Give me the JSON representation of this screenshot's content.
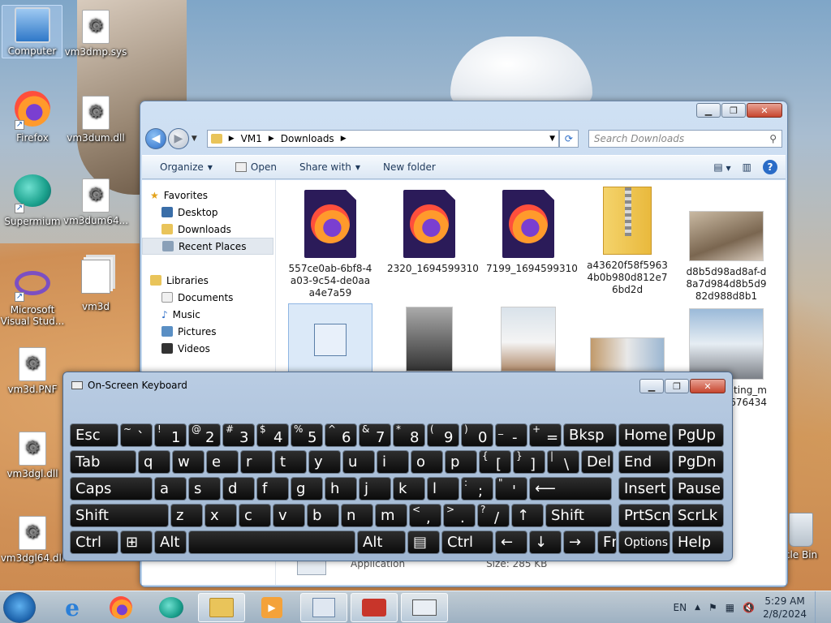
{
  "desktop": {
    "icons": [
      {
        "label": "Computer"
      },
      {
        "label": "vm3dmp.sys"
      },
      {
        "label": "Firefox"
      },
      {
        "label": "vm3dum.dll"
      },
      {
        "label": "Supermium"
      },
      {
        "label": "vm3dum64..."
      },
      {
        "label": "Microsoft Visual Stud..."
      },
      {
        "label": "vm3d"
      },
      {
        "label": "vm3d.PNF"
      },
      {
        "label": "vm3dgl.dll"
      },
      {
        "label": "vm3dgl64.dll"
      },
      {
        "label": "cle Bin"
      }
    ]
  },
  "explorer": {
    "breadcrumb": [
      "VM1",
      "Downloads"
    ],
    "search_placeholder": "Search Downloads",
    "toolbar": {
      "organize": "Organize",
      "open": "Open",
      "share_with": "Share with",
      "new_folder": "New folder"
    },
    "nav": {
      "favorites": "Favorites",
      "desktop": "Desktop",
      "downloads": "Downloads",
      "recent": "Recent Places",
      "libraries": "Libraries",
      "documents": "Documents",
      "music": "Music",
      "pictures": "Pictures",
      "videos": "Videos"
    },
    "files": [
      {
        "name": "557ce0ab-6bf8-4a03-9c54-de0aaa4e7a59"
      },
      {
        "name": "2320_1694599310"
      },
      {
        "name": "7199_1694599310"
      },
      {
        "name": "a43620f58f59634b0b980d812e76bd2d"
      },
      {
        "name": "d8b5d98ad8af-d8a7d984d8b5d982d988d8b1"
      },
      {
        "name": "ting_m\n676434"
      }
    ],
    "details": {
      "type": "Application",
      "size": "Size: 285 KB"
    }
  },
  "keyboard": {
    "title": "On-Screen Keyboard",
    "rows": [
      [
        [
          "Esc",
          ""
        ],
        [
          "~",
          "`"
        ],
        [
          "!",
          "1"
        ],
        [
          "@",
          "2"
        ],
        [
          "#",
          "3"
        ],
        [
          "$",
          "4"
        ],
        [
          "%",
          "5"
        ],
        [
          "^",
          "6"
        ],
        [
          "&",
          "7"
        ],
        [
          "*",
          "8"
        ],
        [
          "(",
          "9"
        ],
        [
          ")",
          "0"
        ],
        [
          "_",
          "-"
        ],
        [
          "+",
          "="
        ],
        [
          "Bksp",
          ""
        ],
        [
          "Home",
          ""
        ],
        [
          "PgUp",
          ""
        ]
      ],
      [
        [
          "Tab",
          ""
        ],
        [
          "q",
          ""
        ],
        [
          "w",
          ""
        ],
        [
          "e",
          ""
        ],
        [
          "r",
          ""
        ],
        [
          "t",
          ""
        ],
        [
          "y",
          ""
        ],
        [
          "u",
          ""
        ],
        [
          "i",
          ""
        ],
        [
          "o",
          ""
        ],
        [
          "p",
          ""
        ],
        [
          "{",
          "["
        ],
        [
          "}",
          "]"
        ],
        [
          "|",
          "\\"
        ],
        [
          "Del",
          ""
        ],
        [
          "End",
          ""
        ],
        [
          "PgDn",
          ""
        ]
      ],
      [
        [
          "Caps",
          ""
        ],
        [
          "a",
          ""
        ],
        [
          "s",
          ""
        ],
        [
          "d",
          ""
        ],
        [
          "f",
          ""
        ],
        [
          "g",
          ""
        ],
        [
          "h",
          ""
        ],
        [
          "j",
          ""
        ],
        [
          "k",
          ""
        ],
        [
          "l",
          ""
        ],
        [
          ":",
          ";"
        ],
        [
          "\"",
          "'"
        ],
        [
          "⟵",
          ""
        ],
        [
          "Insert",
          ""
        ],
        [
          "Pause",
          ""
        ]
      ],
      [
        [
          "Shift",
          ""
        ],
        [
          "z",
          ""
        ],
        [
          "x",
          ""
        ],
        [
          "c",
          ""
        ],
        [
          "v",
          ""
        ],
        [
          "b",
          ""
        ],
        [
          "n",
          ""
        ],
        [
          "m",
          ""
        ],
        [
          "<",
          ","
        ],
        [
          ">",
          "."
        ],
        [
          "?",
          "/"
        ],
        [
          "↑",
          ""
        ],
        [
          "Shift",
          ""
        ],
        [
          "PrtScn",
          ""
        ],
        [
          "ScrLk",
          ""
        ]
      ],
      [
        [
          "Ctrl",
          ""
        ],
        [
          "⊞",
          ""
        ],
        [
          "Alt",
          ""
        ],
        [
          "",
          ""
        ],
        [
          "Alt",
          ""
        ],
        [
          "▤",
          ""
        ],
        [
          "Ctrl",
          ""
        ],
        [
          "←",
          ""
        ],
        [
          "↓",
          ""
        ],
        [
          "→",
          ""
        ],
        [
          "Fn",
          ""
        ],
        [
          "Options",
          ""
        ],
        [
          "Help",
          ""
        ]
      ]
    ]
  },
  "taskbar": {
    "lang": "EN",
    "time": "5:29 AM",
    "date": "2/8/2024"
  }
}
